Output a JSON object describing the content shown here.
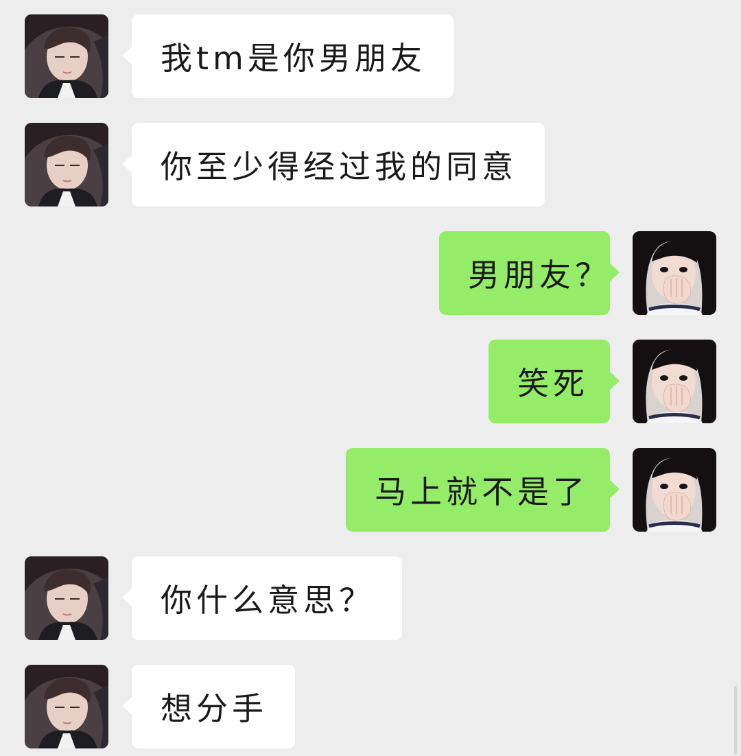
{
  "messages": [
    {
      "sender": "other",
      "text": "我tm是你男朋友"
    },
    {
      "sender": "other",
      "text": "你至少得经过我的同意"
    },
    {
      "sender": "self",
      "text": "男朋友？"
    },
    {
      "sender": "self",
      "text": "笑死"
    },
    {
      "sender": "self",
      "text": "马上就不是了"
    },
    {
      "sender": "other",
      "text": "你什么意思？"
    },
    {
      "sender": "other",
      "text": "想分手"
    }
  ],
  "colors": {
    "background": "#ededed",
    "incoming_bubble": "#ffffff",
    "outgoing_bubble": "#95ec69",
    "text": "#1a1a1a"
  },
  "icons": {
    "other_avatar": "boyfriend-avatar-icon",
    "self_avatar": "girlfriend-avatar-icon"
  }
}
